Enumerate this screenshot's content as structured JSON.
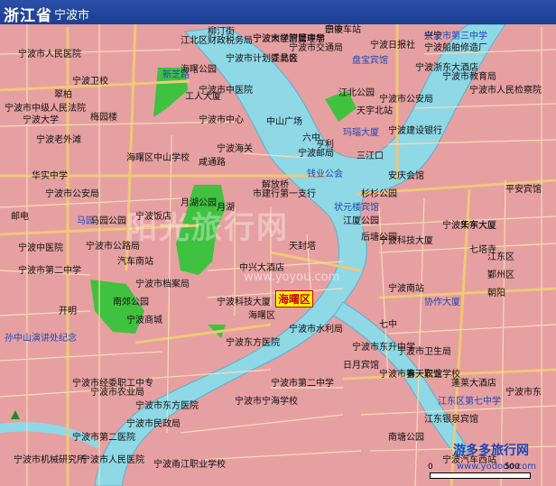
{
  "header": {
    "province": "浙江省",
    "city": "宁波市"
  },
  "highlight": {
    "label": "海曙区"
  },
  "watermark": {
    "big": "阳光旅行网",
    "small": "www.yoyou.com"
  },
  "brand": {
    "name": "游多多旅行网",
    "url": "www.yododo.com",
    "scale_label": "500",
    "scale_zero": "0"
  },
  "colors": {
    "land": "#e6a0a2",
    "water": "#8fd8e6",
    "park": "#3fc23f",
    "road": "#f0c878",
    "title_bar": "#1c3f92",
    "highlight": "#ffff00"
  },
  "labels": [
    "四中",
    "宁波市第三中学",
    "宁波市经营管理局",
    "宁波市交通局",
    "宁波市计划委员会",
    "宁波日报社",
    "盘宝宾馆",
    "宁波船舶修造厂",
    "柳汀街",
    "宁波浙东大酒店",
    "宁波市教育局",
    "宁波市人民检察院",
    "江北区财政税务局",
    "江北区",
    "宁波市中医院",
    "新芝路",
    "海曙公园",
    "工人大厦",
    "宁波市人民医院",
    "宁波卫校",
    "翠柏",
    "宁波市中心",
    "宁波海关",
    "中山广场",
    "六中",
    "江北公园",
    "天宇北站",
    "宁波市中级人民法院",
    "玛瑙大厦",
    "宁波建设银行",
    "宁波大学",
    "梅园楼",
    "宁波老外滩",
    "宁波市公安局",
    "解放桥",
    "亨利",
    "三江口",
    "宁波邮局",
    "海曙区中山学校",
    "咸通路",
    "钱业公会",
    "安庆会馆",
    "华实中学",
    "宁波市公安局",
    "邮电",
    "杉杉公园",
    "平安宾馆",
    "月湖",
    "月湖公园",
    "市建行第一支行",
    "状元楼宾馆",
    "江厦公园",
    "宁波天宇大厦",
    "宁波饭店",
    "华东大厦",
    "后塘公园",
    "宁波科技大厦",
    "七塔寺",
    "马园公园",
    "宁波中医院",
    "马园",
    "鄞州区",
    "江东区",
    "汽车南站",
    "天封塔",
    "宁波市第二中学",
    "中兴大酒店",
    "朝阳",
    "宁波南站",
    "宁波市档案局",
    "协作大厦",
    "开明",
    "宁波市公路局",
    "南郊公园",
    "宁波科技大厦",
    "海曙区",
    "七中",
    "宁波市卫生局",
    "宁波市水利局",
    "宁波商城",
    "孙中山演讲处纪念",
    "宁波东方医院",
    "宁波市东升中学",
    "宁波市经委职工中专",
    "宁波市第一职业学校",
    "日月宾馆",
    "春天宾馆",
    "蓬莱大酒店",
    "宁波市东",
    "宁波市宁海学校",
    "江东区第七中学",
    "宁波市民政局",
    "江东银泉宾馆",
    "宁波甬江职业学校",
    "宁波市人民医院",
    "宁波市机械研究所",
    "宁波汽车西站",
    "宁波市第二医院",
    "宁波市第二中学",
    "南塘公园",
    "宁波市农业局",
    "宁波市东方医院",
    "宁波车站",
    "兴宁",
    "宁波大学附属中学"
  ]
}
